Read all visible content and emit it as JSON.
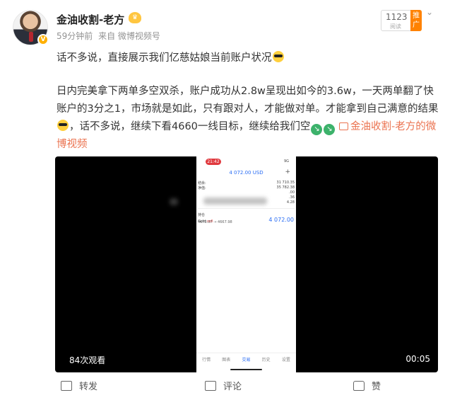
{
  "post": {
    "author": "金油收割-老方",
    "time": "59分钟前",
    "source": "来自 微博视频号",
    "rank_number": "1123",
    "rank_sub": "阅读",
    "rank_tag": "推广",
    "paragraph1": "话不多说，直接展示我们亿慈姑娘当前账户状况",
    "paragraph2_part1": "日内完美拿下两单多空双杀，账户成功从2.8w呈现出如今的3.6w，一天两单翻了快账户的3分之1，市场就是如此，只有跟对人，才能做对单。才能拿到自己满意的结果",
    "paragraph2_part2": "，话不多说，继续下看4660一线目标，继续给我们空",
    "link_text": "金油收割-老方的微博视频"
  },
  "video": {
    "views": "84次观看",
    "duration": "00:05",
    "phone": {
      "status_time": "21:42",
      "status_signal": "9G",
      "balance": "4 072.00 USD",
      "rows": [
        {
          "label": "结余:",
          "value": "31 710.35"
        },
        {
          "label": "净值:",
          "value": "35 782.38"
        },
        {
          "label": "",
          "value": ".00"
        },
        {
          "label": "",
          "value": ".36"
        },
        {
          "label": "",
          "value": "4.28"
        }
      ],
      "positions_label": "持仓",
      "position_symbol": "Gold",
      "position_side": "sell",
      "position_range": "4673.07 → 4667.98",
      "position_value": "4 072.00",
      "nav": [
        "行情",
        "图表",
        "交易",
        "历史",
        "设置"
      ]
    }
  },
  "actions": {
    "repost": "转发",
    "comment": "评论",
    "like": "赞"
  }
}
